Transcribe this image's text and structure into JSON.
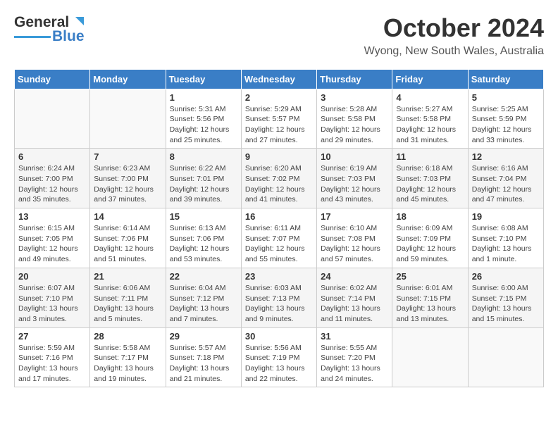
{
  "header": {
    "logo_general": "General",
    "logo_blue": "Blue",
    "title": "October 2024",
    "subtitle": "Wyong, New South Wales, Australia"
  },
  "weekdays": [
    "Sunday",
    "Monday",
    "Tuesday",
    "Wednesday",
    "Thursday",
    "Friday",
    "Saturday"
  ],
  "weeks": [
    [
      {
        "day": "",
        "detail": ""
      },
      {
        "day": "",
        "detail": ""
      },
      {
        "day": "1",
        "detail": "Sunrise: 5:31 AM\nSunset: 5:56 PM\nDaylight: 12 hours\nand 25 minutes."
      },
      {
        "day": "2",
        "detail": "Sunrise: 5:29 AM\nSunset: 5:57 PM\nDaylight: 12 hours\nand 27 minutes."
      },
      {
        "day": "3",
        "detail": "Sunrise: 5:28 AM\nSunset: 5:58 PM\nDaylight: 12 hours\nand 29 minutes."
      },
      {
        "day": "4",
        "detail": "Sunrise: 5:27 AM\nSunset: 5:58 PM\nDaylight: 12 hours\nand 31 minutes."
      },
      {
        "day": "5",
        "detail": "Sunrise: 5:25 AM\nSunset: 5:59 PM\nDaylight: 12 hours\nand 33 minutes."
      }
    ],
    [
      {
        "day": "6",
        "detail": "Sunrise: 6:24 AM\nSunset: 7:00 PM\nDaylight: 12 hours\nand 35 minutes."
      },
      {
        "day": "7",
        "detail": "Sunrise: 6:23 AM\nSunset: 7:00 PM\nDaylight: 12 hours\nand 37 minutes."
      },
      {
        "day": "8",
        "detail": "Sunrise: 6:22 AM\nSunset: 7:01 PM\nDaylight: 12 hours\nand 39 minutes."
      },
      {
        "day": "9",
        "detail": "Sunrise: 6:20 AM\nSunset: 7:02 PM\nDaylight: 12 hours\nand 41 minutes."
      },
      {
        "day": "10",
        "detail": "Sunrise: 6:19 AM\nSunset: 7:03 PM\nDaylight: 12 hours\nand 43 minutes."
      },
      {
        "day": "11",
        "detail": "Sunrise: 6:18 AM\nSunset: 7:03 PM\nDaylight: 12 hours\nand 45 minutes."
      },
      {
        "day": "12",
        "detail": "Sunrise: 6:16 AM\nSunset: 7:04 PM\nDaylight: 12 hours\nand 47 minutes."
      }
    ],
    [
      {
        "day": "13",
        "detail": "Sunrise: 6:15 AM\nSunset: 7:05 PM\nDaylight: 12 hours\nand 49 minutes."
      },
      {
        "day": "14",
        "detail": "Sunrise: 6:14 AM\nSunset: 7:06 PM\nDaylight: 12 hours\nand 51 minutes."
      },
      {
        "day": "15",
        "detail": "Sunrise: 6:13 AM\nSunset: 7:06 PM\nDaylight: 12 hours\nand 53 minutes."
      },
      {
        "day": "16",
        "detail": "Sunrise: 6:11 AM\nSunset: 7:07 PM\nDaylight: 12 hours\nand 55 minutes."
      },
      {
        "day": "17",
        "detail": "Sunrise: 6:10 AM\nSunset: 7:08 PM\nDaylight: 12 hours\nand 57 minutes."
      },
      {
        "day": "18",
        "detail": "Sunrise: 6:09 AM\nSunset: 7:09 PM\nDaylight: 12 hours\nand 59 minutes."
      },
      {
        "day": "19",
        "detail": "Sunrise: 6:08 AM\nSunset: 7:10 PM\nDaylight: 13 hours\nand 1 minute."
      }
    ],
    [
      {
        "day": "20",
        "detail": "Sunrise: 6:07 AM\nSunset: 7:10 PM\nDaylight: 13 hours\nand 3 minutes."
      },
      {
        "day": "21",
        "detail": "Sunrise: 6:06 AM\nSunset: 7:11 PM\nDaylight: 13 hours\nand 5 minutes."
      },
      {
        "day": "22",
        "detail": "Sunrise: 6:04 AM\nSunset: 7:12 PM\nDaylight: 13 hours\nand 7 minutes."
      },
      {
        "day": "23",
        "detail": "Sunrise: 6:03 AM\nSunset: 7:13 PM\nDaylight: 13 hours\nand 9 minutes."
      },
      {
        "day": "24",
        "detail": "Sunrise: 6:02 AM\nSunset: 7:14 PM\nDaylight: 13 hours\nand 11 minutes."
      },
      {
        "day": "25",
        "detail": "Sunrise: 6:01 AM\nSunset: 7:15 PM\nDaylight: 13 hours\nand 13 minutes."
      },
      {
        "day": "26",
        "detail": "Sunrise: 6:00 AM\nSunset: 7:15 PM\nDaylight: 13 hours\nand 15 minutes."
      }
    ],
    [
      {
        "day": "27",
        "detail": "Sunrise: 5:59 AM\nSunset: 7:16 PM\nDaylight: 13 hours\nand 17 minutes."
      },
      {
        "day": "28",
        "detail": "Sunrise: 5:58 AM\nSunset: 7:17 PM\nDaylight: 13 hours\nand 19 minutes."
      },
      {
        "day": "29",
        "detail": "Sunrise: 5:57 AM\nSunset: 7:18 PM\nDaylight: 13 hours\nand 21 minutes."
      },
      {
        "day": "30",
        "detail": "Sunrise: 5:56 AM\nSunset: 7:19 PM\nDaylight: 13 hours\nand 22 minutes."
      },
      {
        "day": "31",
        "detail": "Sunrise: 5:55 AM\nSunset: 7:20 PM\nDaylight: 13 hours\nand 24 minutes."
      },
      {
        "day": "",
        "detail": ""
      },
      {
        "day": "",
        "detail": ""
      }
    ]
  ]
}
